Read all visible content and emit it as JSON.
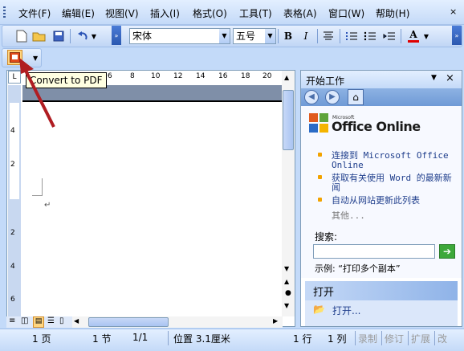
{
  "menu": [
    "文件(F)",
    "编辑(E)",
    "视图(V)",
    "插入(I)",
    "格式(O)",
    "工具(T)",
    "表格(A)",
    "窗口(W)",
    "帮助(H)"
  ],
  "toolbar": {
    "font_name": "宋体",
    "font_size": "五号",
    "bold": "B",
    "italic": "I",
    "font_color_glyph": "A"
  },
  "tooltip": "Convert to PDF",
  "ruler": {
    "h_ticks": [
      "6",
      "8",
      "10",
      "12",
      "14",
      "16",
      "18",
      "20"
    ],
    "v_ticks": [
      "4",
      "2",
      "2",
      "4",
      "6"
    ]
  },
  "document": {
    "paragraph_mark": "↵"
  },
  "taskpane": {
    "title": "开始工作",
    "logo_office": "Office Online",
    "logo_microsoft": "Microsoft",
    "links": [
      "连接到 Microsoft Office Online",
      "获取有关使用 Word 的最新新闻",
      "自动从网站更新此列表"
    ],
    "more": "其他...",
    "search_label": "搜索:",
    "search_value": "",
    "example": "示例:  “打印多个副本”",
    "open_section": "打开",
    "open_link": "打开..."
  },
  "status": {
    "page": "1 页",
    "section": "1 节",
    "page_of": "1/1",
    "position": "位置 3.1厘米",
    "line": "1 行",
    "column": "1 列",
    "rec": "录制",
    "trk": "修订",
    "ext": "扩展",
    "ovr": "改"
  }
}
